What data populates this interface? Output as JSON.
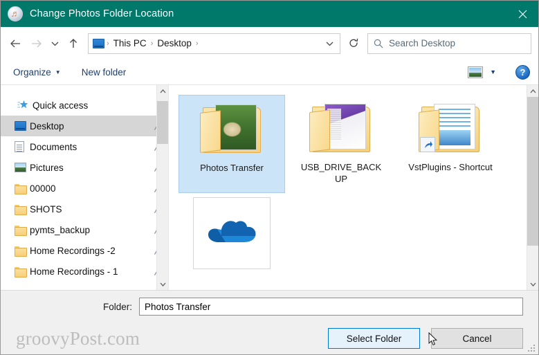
{
  "window": {
    "title": "Change Photos Folder Location",
    "title_icon": "itunes-music-note-icon",
    "close_label": "✕",
    "titlebar_color": "#00796b"
  },
  "navbar": {
    "back_icon": "arrow-left-icon",
    "forward_icon": "arrow-right-icon",
    "recent_icon": "chevron-down-icon",
    "up_icon": "arrow-up-icon",
    "breadcrumb": {
      "root_icon": "this-pc-monitor-icon",
      "items": [
        "This PC",
        "Desktop"
      ],
      "separator": "›",
      "dropdown_icon": "chevron-down-icon"
    },
    "refresh_icon": "refresh-icon",
    "search": {
      "icon": "search-icon",
      "placeholder": "Search Desktop",
      "value": ""
    }
  },
  "commandbar": {
    "organize_label": "Organize",
    "organize_caret": "▼",
    "new_folder_label": "New folder",
    "view_icon": "view-mode-picture-icon",
    "view_caret": "▼",
    "help_label": "?",
    "help_icon": "help-circle-icon"
  },
  "sidebar": {
    "items": [
      {
        "label": "Quick access",
        "icon": "quick-access-star-icon",
        "pinned": false,
        "selected": false,
        "group": true
      },
      {
        "label": "Desktop",
        "icon": "desktop-monitor-icon",
        "pinned": true,
        "selected": true,
        "group": false
      },
      {
        "label": "Documents",
        "icon": "documents-icon",
        "pinned": true,
        "selected": false,
        "group": false
      },
      {
        "label": "Pictures",
        "icon": "pictures-icon",
        "pinned": true,
        "selected": false,
        "group": false
      },
      {
        "label": "00000",
        "icon": "folder-icon",
        "pinned": true,
        "selected": false,
        "group": false
      },
      {
        "label": "SHOTS",
        "icon": "folder-icon",
        "pinned": true,
        "selected": false,
        "group": false
      },
      {
        "label": "pymts_backup",
        "icon": "folder-icon",
        "pinned": true,
        "selected": false,
        "group": false
      },
      {
        "label": "Home Recordings -2",
        "icon": "folder-icon",
        "pinned": true,
        "selected": false,
        "group": false
      },
      {
        "label": "Home Recordings - 1",
        "icon": "folder-icon",
        "pinned": true,
        "selected": false,
        "group": false
      }
    ],
    "scrollbar": {
      "up_icon": "▲",
      "down_icon": "▼"
    }
  },
  "files": {
    "items": [
      {
        "name": "Photos Transfer",
        "type": "folder-photo-thumbnail",
        "selected": true,
        "shortcut": false
      },
      {
        "name": "USB_DRIVE_BACKUP",
        "type": "folder-screenshot-thumbnail",
        "selected": false,
        "shortcut": false
      },
      {
        "name": "VstPlugins - Shortcut",
        "type": "folder-document-thumbnail",
        "selected": false,
        "shortcut": true
      },
      {
        "name": "",
        "type": "onedrive-cloud-icon",
        "selected": false,
        "shortcut": false
      }
    ],
    "scrollbar": {
      "up_icon": "▲",
      "down_icon": "▼"
    }
  },
  "footer": {
    "folder_label": "Folder:",
    "folder_value": "Photos Transfer",
    "watermark": "groovyPost.com",
    "select_button": "Select Folder",
    "cancel_button": "Cancel",
    "accent_color": "#0078d7"
  }
}
